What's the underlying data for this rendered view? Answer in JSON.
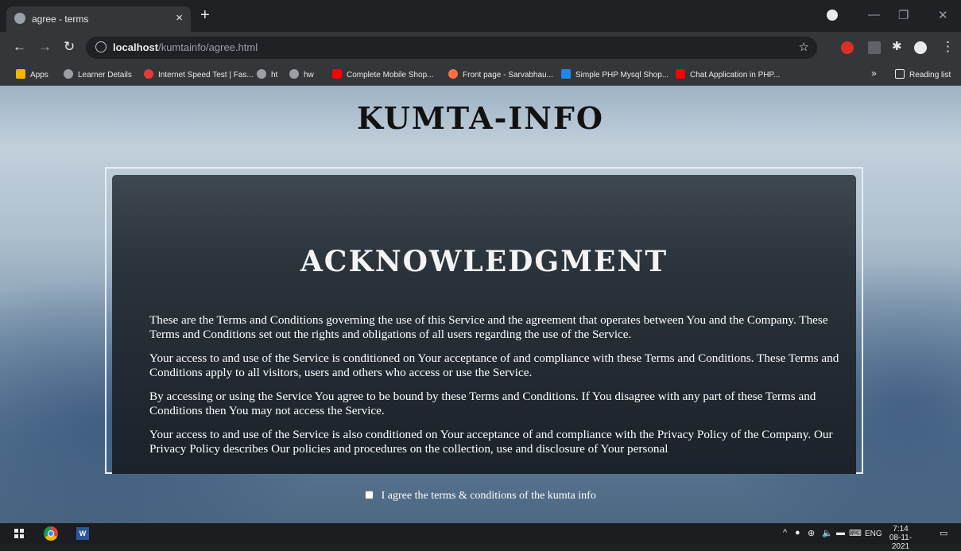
{
  "browser": {
    "tab_title": "agree - terms",
    "tab_close": "×",
    "new_tab": "+",
    "url_host": "localhost",
    "url_path": "/kumtainfo/agree.html",
    "bookmarks": [
      {
        "label": "Apps",
        "icon": "apps-grid-icon",
        "color": "#f4b400"
      },
      {
        "label": "Learner Details",
        "icon": "globe-icon",
        "color": "#9aa0a6"
      },
      {
        "label": "Internet Speed Test | Fas...",
        "icon": "speedtest-icon",
        "color": "#e53935"
      },
      {
        "label": "ht",
        "icon": "globe-icon",
        "color": "#9aa0a6"
      },
      {
        "label": "hw",
        "icon": "globe-icon",
        "color": "#9aa0a6"
      },
      {
        "label": "Complete Mobile Shop...",
        "icon": "youtube-icon",
        "color": "#ff0000"
      },
      {
        "label": "Front page - Sarvabhau...",
        "icon": "site-icon",
        "color": "#ff7043"
      },
      {
        "label": "Simple PHP Mysql Shop...",
        "icon": "w-icon",
        "color": "#1e88e5"
      },
      {
        "label": "Chat Application in PHP...",
        "icon": "youtube-icon",
        "color": "#ff0000"
      }
    ],
    "overflow": "»",
    "reading_list": "Reading list"
  },
  "page": {
    "site_title": "KUMTA-INFO",
    "heading": "ACKNOWLEDGMENT",
    "paragraphs": [
      "These are the Terms and Conditions governing the use of this Service and the agreement that operates between You and the Company. These Terms and Conditions set out the rights and obligations of all users regarding the use of the Service.",
      "Your access to and use of the Service is conditioned on Your acceptance of and compliance with these Terms and Conditions. These Terms and Conditions apply to all visitors, users and others who access or use the Service.",
      "By accessing or using the Service You agree to be bound by these Terms and Conditions. If You disagree with any part of these Terms and Conditions then You may not access the Service.",
      "Your access to and use of the Service is also conditioned on Your acceptance of and compliance with the Privacy Policy of the Company. Our Privacy Policy describes Our policies and procedures on the collection, use and disclosure of Your personal"
    ],
    "agree_label": "I agree the terms & conditions of the kumta info"
  },
  "taskbar": {
    "language": "ENG",
    "time": "7:14",
    "date": "08-11-2021"
  }
}
